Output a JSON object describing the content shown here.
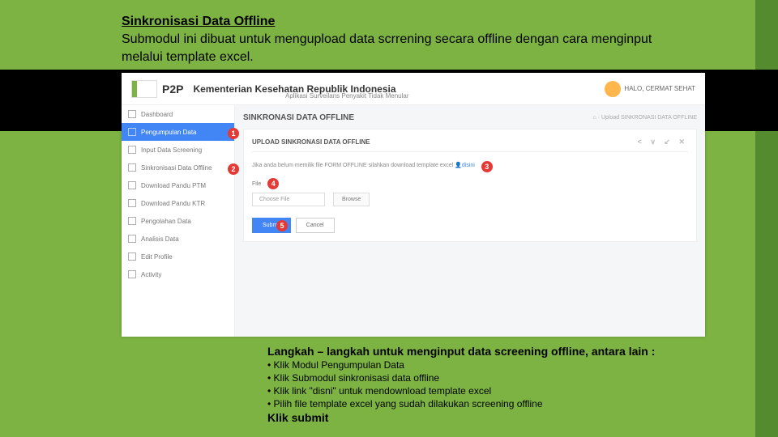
{
  "heading": {
    "title": "Sinkronisasi Data Offline",
    "desc": "Submodul ini dibuat untuk mengupload data scrrening secara offline dengan cara menginput melalui template excel."
  },
  "app": {
    "brand": "P2P",
    "ministry": "Kementerian Kesehatan Republik Indonesia",
    "subtitle": "Aplikasi Surveilans Penyakit Tidak Menular",
    "user": "HALO, CERMAT SEHAT"
  },
  "sidebar": {
    "items": [
      {
        "label": "Dashboard"
      },
      {
        "label": "Pengumpulan Data"
      },
      {
        "label": "Input Data Screening"
      },
      {
        "label": "Sinkronisasi Data Offline"
      },
      {
        "label": "Download Pandu PTM"
      },
      {
        "label": "Download Pandu KTR"
      },
      {
        "label": "Pengolahan Data"
      },
      {
        "label": "Analisis Data"
      },
      {
        "label": "Edit Profile"
      },
      {
        "label": "Activity"
      }
    ]
  },
  "page": {
    "title": "SINKRONASI DATA OFFLINE",
    "crumb_home": "⌂",
    "crumb": "Upload SINKRONASI DATA OFFLINE",
    "card_title": "UPLOAD SINKRONASI DATA OFFLINE",
    "tools": "< ∨ ↙ ✕",
    "note_pre": "Jika anda belum memilik file FORM OFFLINE silahkan download template excel ",
    "note_link": "disini",
    "file_label": "File",
    "choose": "Choose File",
    "browse": "Browse",
    "submit": "Submit",
    "cancel": "Cancel"
  },
  "markers": {
    "m1": "1",
    "m2": "2",
    "m3": "3",
    "m4": "4",
    "m5": "5"
  },
  "steps": {
    "lead": "Langkah – langkah untuk menginput data screening offline, antara lain :",
    "b1": "• Klik Modul Pengumpulan Data",
    "b2": "• Klik Submodul sinkronisasi data offline",
    "b3": "• Klik link \"disni\" untuk mendownload template excel",
    "b4": "• Pilih file template excel yang sudah dilakukan screening offline",
    "last": "Klik submit"
  }
}
